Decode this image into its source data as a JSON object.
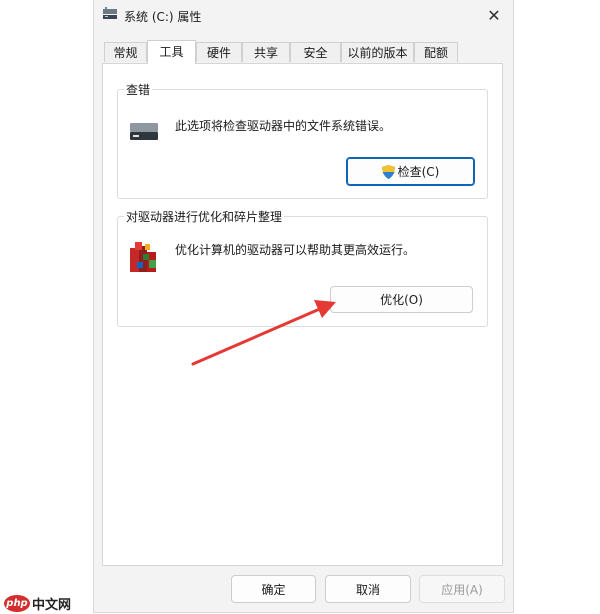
{
  "window": {
    "title": "系统 (C:) 属性",
    "close_icon": "close-icon"
  },
  "tabs": [
    {
      "label": "常规"
    },
    {
      "label": "工具",
      "active": true
    },
    {
      "label": "硬件"
    },
    {
      "label": "共享"
    },
    {
      "label": "安全"
    },
    {
      "label": "以前的版本"
    },
    {
      "label": "配额"
    }
  ],
  "check_group": {
    "title": "查错",
    "description": "此选项将检查驱动器中的文件系统错误。",
    "button_label": "检查(C)",
    "icon": "drive-icon",
    "button_icon": "uac-shield-icon"
  },
  "optimize_group": {
    "title": "对驱动器进行优化和碎片整理",
    "description": "优化计算机的驱动器可以帮助其更高效运行。",
    "button_label": "优化(O)",
    "icon": "defrag-icon"
  },
  "footer": {
    "ok_label": "确定",
    "cancel_label": "取消",
    "apply_label": "应用(A)"
  },
  "watermark": {
    "logo_text": "php",
    "site_text": "中文网"
  },
  "colors": {
    "accent_border": "#0f64b8",
    "annotation_arrow": "#e53935",
    "dialog_bg": "#f3f3f3"
  }
}
